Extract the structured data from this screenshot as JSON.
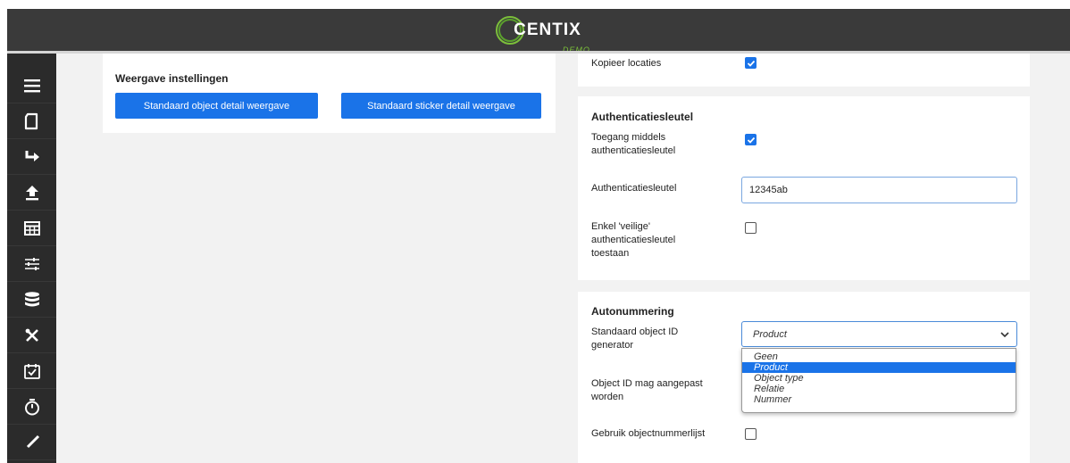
{
  "header": {
    "logo_text": "CENTIX",
    "logo_subtext": "DEMO"
  },
  "sidebar": {
    "items": [
      {
        "icon": "menu-icon"
      },
      {
        "icon": "document-icon"
      },
      {
        "icon": "redirect-arrow-icon"
      },
      {
        "icon": "upload-icon"
      },
      {
        "icon": "table-icon"
      },
      {
        "icon": "sliders-icon"
      },
      {
        "icon": "database-icon"
      },
      {
        "icon": "tools-icon"
      },
      {
        "icon": "calendar-check-icon"
      },
      {
        "icon": "stopwatch-icon"
      },
      {
        "icon": "pen-icon"
      }
    ]
  },
  "weergave": {
    "title": "Weergave instellingen",
    "btn_object": "Standaard object detail weergave",
    "btn_sticker": "Standaard sticker detail weergave"
  },
  "kopieer": {
    "label": "Kopieer locaties",
    "checked": true
  },
  "auth": {
    "title": "Authenticatiesleutel",
    "toegang_label_line1": "Toegang middels",
    "toegang_label_line2": "authenticatiesleutel",
    "toegang_checked": true,
    "sleutel_label": "Authenticatiesleutel",
    "sleutel_value": "12345ab",
    "veilig_label_line1": "Enkel 'veilige'",
    "veilig_label_line2": "authenticatiesleutel",
    "veilig_label_line3": "toestaan",
    "veilig_checked": false
  },
  "autonummering": {
    "title": "Autonummering",
    "generator_label_line1": "Standaard object ID",
    "generator_label_line2": "generator",
    "generator_value": "Product",
    "options": [
      "Geen",
      "Product",
      "Object type",
      "Relatie",
      "Nummer"
    ],
    "selected_option": "Product",
    "aanpassen_label_line1": "Object ID mag aangepast",
    "aanpassen_label_line2": "worden",
    "lijst_label": "Gebruik objectnummerlijst",
    "lijst_checked": false
  },
  "colors": {
    "accent": "#1a73e8",
    "topbar": "#3a3a3a",
    "sidebar": "#2b2b2b",
    "brand_green": "#7bbf3a"
  }
}
